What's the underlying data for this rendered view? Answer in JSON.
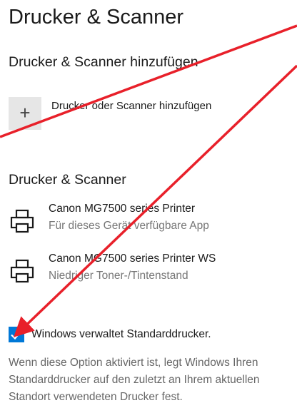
{
  "page_title": "Drucker & Scanner",
  "add_section": {
    "heading": "Drucker & Scanner hinzufügen",
    "add_icon": "plus-icon",
    "add_label": "Drucker oder Scanner hinzufügen"
  },
  "devices_section": {
    "heading": "Drucker & Scanner",
    "printers": [
      {
        "name": "Canon MG7500 series Printer",
        "status": "Für dieses Gerät verfügbare App",
        "icon": "printer-icon"
      },
      {
        "name": "Canon MG7500 series Printer WS",
        "status": "Niedriger Toner-/Tintenstand",
        "icon": "printer-icon"
      }
    ]
  },
  "default_printer": {
    "checked": true,
    "label": "Windows verwaltet Standarddrucker.",
    "description_lines": [
      "Wenn diese Option aktiviert ist, legt Windows Ihren",
      "Standarddrucker auf den zuletzt an Ihrem aktuellen",
      "Standort verwendeten Drucker fest."
    ]
  },
  "colors": {
    "accent": "#0078d7",
    "annotation": "#e8202a"
  }
}
